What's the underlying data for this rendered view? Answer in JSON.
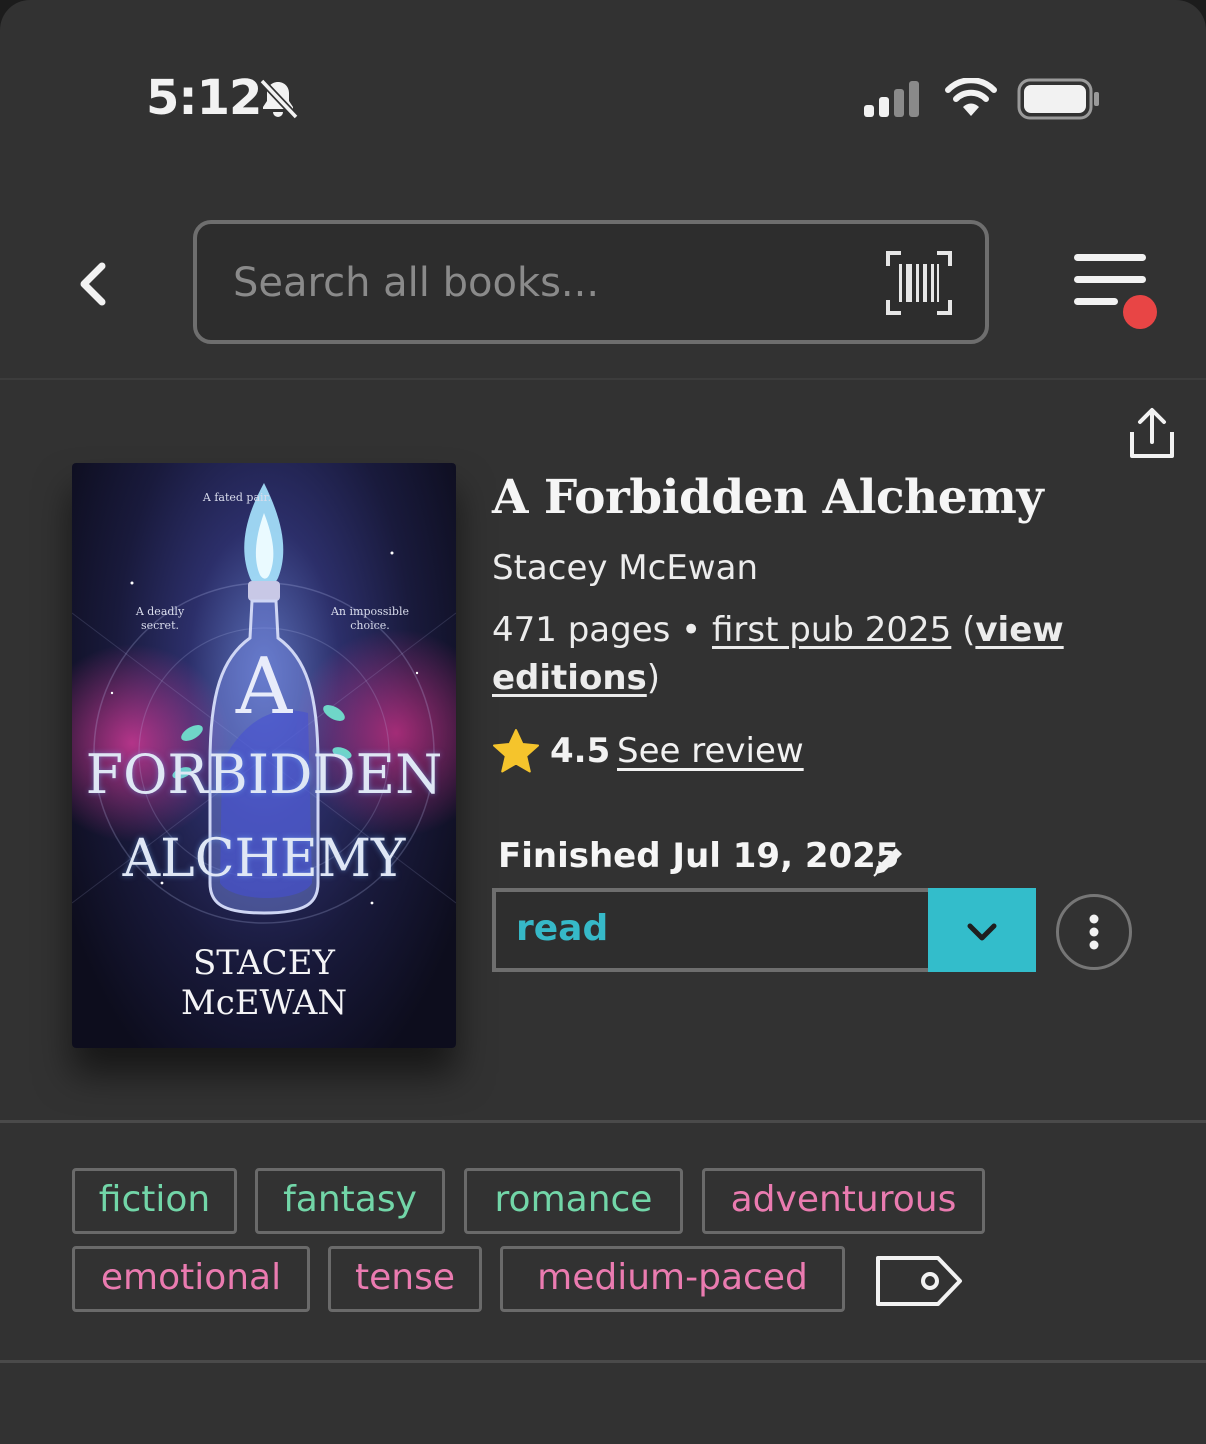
{
  "status_bar": {
    "time": "5:12",
    "icons": [
      "bell-off-icon",
      "cellular-signal-icon",
      "wifi-icon",
      "battery-icon"
    ]
  },
  "header": {
    "search_placeholder": "Search all books...",
    "icons": [
      "back-icon",
      "barcode-scan-icon",
      "menu-icon"
    ],
    "menu_notification_color": "#e84545"
  },
  "book": {
    "cover": {
      "title_line1": "FORBIDDEN",
      "title_line2": "ALCHEMY",
      "title_letter": "A",
      "author_line1": "STACEY",
      "author_line2": "McEWAN",
      "tagline_top": "A fated pair.",
      "tagline_left": "A deadly secret.",
      "tagline_right": "An impossible choice."
    },
    "title": "A Forbidden Alchemy",
    "author": "Stacey McEwan",
    "pages": "471 pages",
    "separator": " • ",
    "first_pub": "first pub 2025",
    "view_editions_open": " (",
    "view_editions": "view editions",
    "view_editions_close": ")",
    "rating": "4.5",
    "see_review": "See review",
    "finished": "Finished Jul 19, 2025",
    "reading_status": "read"
  },
  "tags": {
    "genres": [
      "fiction",
      "fantasy",
      "romance"
    ],
    "moods": [
      "adventurous",
      "emotional",
      "tense",
      "medium-paced"
    ]
  },
  "colors": {
    "background": "#323232",
    "accent_teal": "#33bdcb",
    "genre_green": "#72d6a8",
    "mood_pink": "#ea7bb0",
    "star_yellow": "#f5c42c"
  }
}
